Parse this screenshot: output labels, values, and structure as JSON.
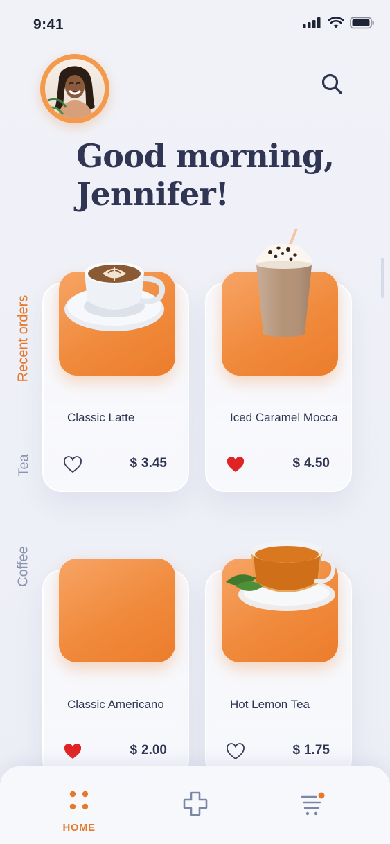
{
  "status_bar": {
    "time": "9:41",
    "icons": [
      "cellular-signal-icon",
      "wifi-icon",
      "battery-icon"
    ]
  },
  "header": {
    "avatar": "user-avatar",
    "search_icon": "search-icon",
    "greeting_line1": "Good morning,",
    "greeting_line2": "Jennifer!"
  },
  "categories": [
    {
      "label": "Recent orders",
      "active": true
    },
    {
      "label": "Tea",
      "active": false
    },
    {
      "label": "Coffee",
      "active": false
    }
  ],
  "products": [
    {
      "name": "Classic Latte",
      "currency": "$",
      "price": "3.45",
      "favorite": false,
      "image": "latte-cup"
    },
    {
      "name": "Iced Caramel Mocca",
      "currency": "$",
      "price": "4.50",
      "favorite": true,
      "image": "iced-mocca-cup"
    },
    {
      "name": "Classic Americano",
      "currency": "$",
      "price": "2.00",
      "favorite": true,
      "image": "none"
    },
    {
      "name": "Hot Lemon Tea",
      "currency": "$",
      "price": "1.75",
      "favorite": false,
      "image": "tea-cup"
    }
  ],
  "bottom_nav": {
    "home_label": "HOME",
    "items": [
      "home-icon",
      "add-icon",
      "cart-icon"
    ]
  },
  "colors": {
    "accent": "#e6782a",
    "text_primary": "#2f3553",
    "text_muted": "#8b93b0",
    "card_orange": "#f08a3c",
    "heart_red": "#e02424",
    "background": "#eef0f7"
  }
}
